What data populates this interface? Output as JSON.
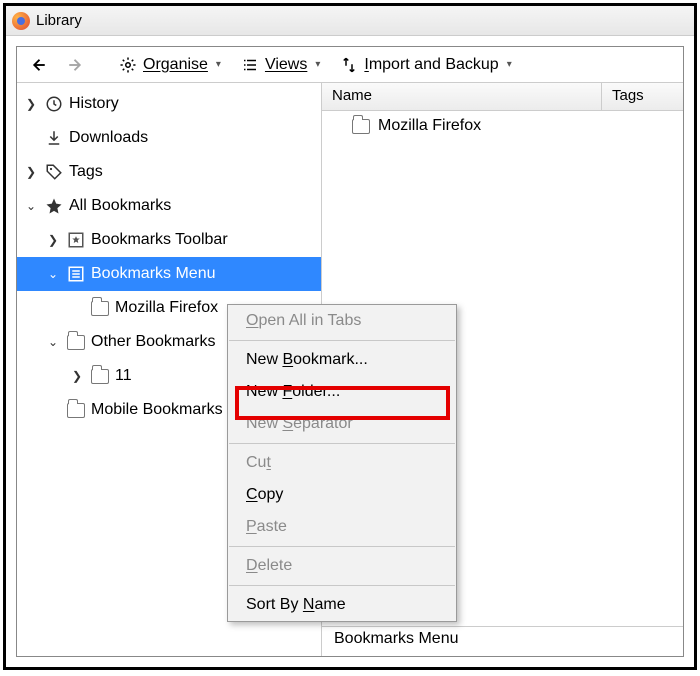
{
  "window": {
    "title": "Library"
  },
  "toolbar": {
    "organise": "Organise",
    "views": "Views",
    "import": "Import and Backup"
  },
  "tree": {
    "history": "History",
    "downloads": "Downloads",
    "tags": "Tags",
    "all_bookmarks": "All Bookmarks",
    "bm_toolbar": "Bookmarks Toolbar",
    "bm_menu": "Bookmarks Menu",
    "mozilla": "Mozilla Firefox",
    "other": "Other Bookmarks",
    "eleven": "11",
    "mobile": "Mobile Bookmarks"
  },
  "columns": {
    "name": "Name",
    "tags": "Tags"
  },
  "list": {
    "item0": "Mozilla Firefox"
  },
  "status": {
    "text": "Bookmarks Menu"
  },
  "ctx": {
    "open_all": "Open All in Tabs",
    "new_bookmark": "New Bookmark...",
    "new_folder": "New Folder...",
    "new_sep": "New Separator",
    "cut": "Cut",
    "copy": "Copy",
    "paste": "Paste",
    "delete": "Delete",
    "sort": "Sort By Name"
  }
}
